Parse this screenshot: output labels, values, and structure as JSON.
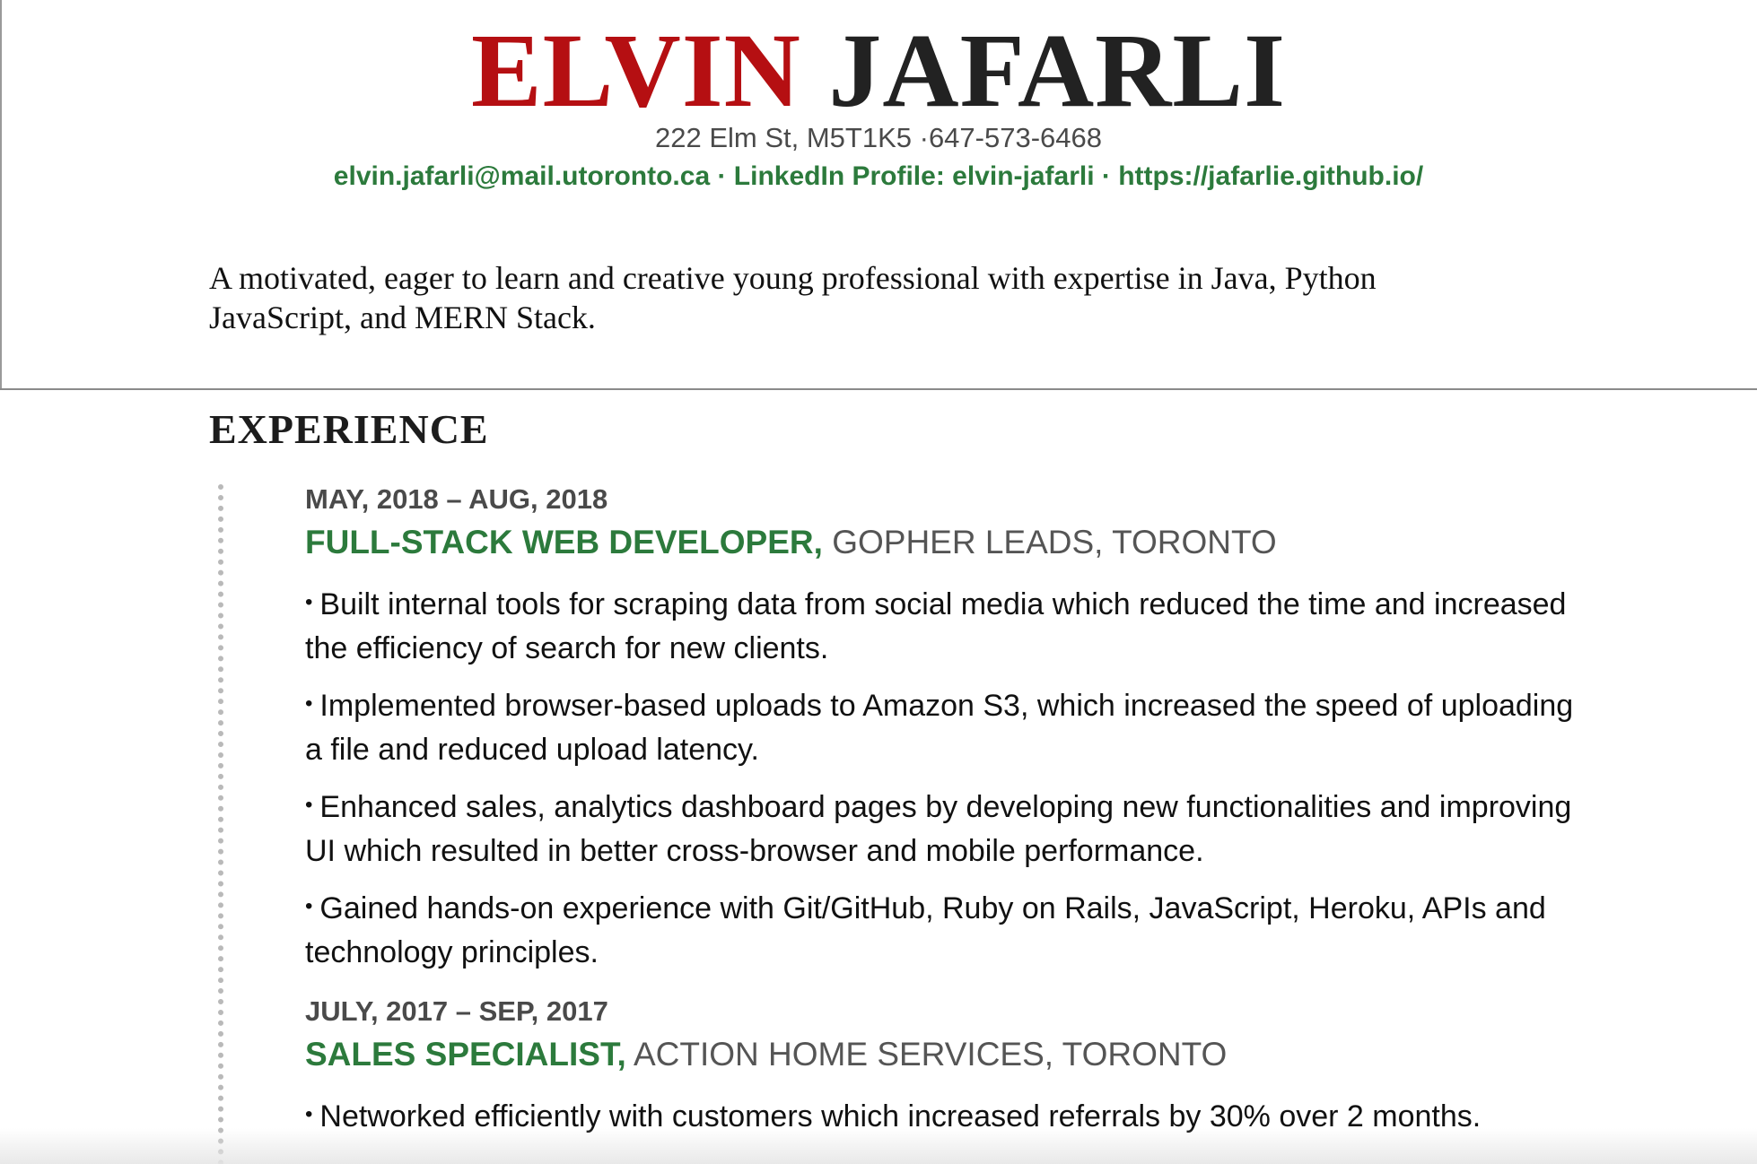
{
  "header": {
    "first_name": "ELVIN",
    "last_name": "JAFARLI",
    "address": "222 Elm St, M5T1K5 ·647-573-6468",
    "contacts": "elvin.jafarli@mail.utoronto.ca · LinkedIn Profile: elvin-jafarli · https://jafarlie.github.io/"
  },
  "summary": "A motivated, eager to learn and creative young professional with expertise in Java, Python JavaScript, and MERN Stack.",
  "experience": {
    "title": "EXPERIENCE",
    "jobs": [
      {
        "dates": "MAY, 2018 – AUG, 2018",
        "title": "FULL-STACK WEB DEVELOPER,",
        "company": "GOPHER LEADS, TORONTO",
        "bullets": [
          "Built internal tools for scraping data from social media which reduced the time and increased the efficiency of search for new clients.",
          "Implemented browser-based uploads to Amazon S3, which increased the speed of uploading a file and reduced upload latency.",
          "Enhanced sales, analytics dashboard pages by developing new functionalities and improving UI which resulted in better cross-browser and mobile performance.",
          "Gained hands-on experience with Git/GitHub, Ruby on Rails, JavaScript, Heroku, APIs and technology principles."
        ]
      },
      {
        "dates": "JULY, 2017 – SEP, 2017",
        "title": "SALES SPECIALIST,",
        "company": "ACTION HOME SERVICES, TORONTO",
        "bullets": [
          "Networked efficiently with customers which increased referrals by 30% over 2 months."
        ]
      }
    ]
  },
  "bullet_symbol": "•",
  "colors": {
    "name_accent": "#b50f12",
    "link_green": "#2c7a3c",
    "muted_gray": "#4a4a4a"
  }
}
